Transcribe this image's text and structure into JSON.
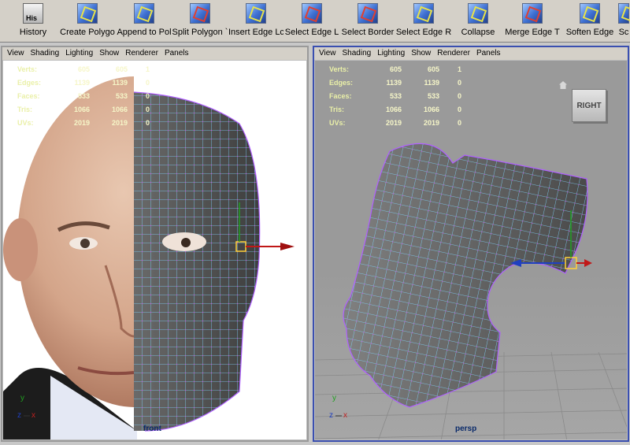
{
  "shelf": {
    "buttons": [
      {
        "label": "History",
        "icon": "history-icon",
        "badge": "His"
      },
      {
        "label": "Create Polygo",
        "icon": "create-polygon-icon"
      },
      {
        "label": "Append to Pol",
        "icon": "append-polygon-icon"
      },
      {
        "label": "Split Polygon `",
        "icon": "split-polygon-icon"
      },
      {
        "label": "Insert Edge Lc",
        "icon": "insert-edge-loop-icon"
      },
      {
        "label": "Select Edge L",
        "icon": "select-edge-loop-icon"
      },
      {
        "label": "Select Border",
        "icon": "select-border-icon"
      },
      {
        "label": "Select Edge R",
        "icon": "select-edge-ring-icon"
      },
      {
        "label": "Collapse",
        "icon": "collapse-icon"
      },
      {
        "label": "Merge Edge T",
        "icon": "merge-edge-icon"
      },
      {
        "label": "Soften Edge",
        "icon": "soften-edge-icon"
      },
      {
        "label": "Sc",
        "icon": "sculpt-icon"
      }
    ]
  },
  "panels": {
    "menu": [
      "View",
      "Shading",
      "Lighting",
      "Show",
      "Renderer",
      "Panels"
    ],
    "front": {
      "camera": "front",
      "hud": [
        {
          "name": "Verts:",
          "a": "605",
          "b": "605",
          "c": "1"
        },
        {
          "name": "Edges:",
          "a": "1139",
          "b": "1139",
          "c": "0"
        },
        {
          "name": "Faces:",
          "a": "533",
          "b": "533",
          "c": "0"
        },
        {
          "name": "Tris:",
          "a": "1066",
          "b": "1066",
          "c": "0"
        },
        {
          "name": "UVs:",
          "a": "2019",
          "b": "2019",
          "c": "0"
        }
      ],
      "axis": {
        "up": "y",
        "right": "x",
        "origin": "z"
      }
    },
    "persp": {
      "camera": "persp",
      "viewcube": "RIGHT",
      "hud": [
        {
          "name": "Verts:",
          "a": "605",
          "b": "605",
          "c": "1"
        },
        {
          "name": "Edges:",
          "a": "1139",
          "b": "1139",
          "c": "0"
        },
        {
          "name": "Faces:",
          "a": "533",
          "b": "533",
          "c": "0"
        },
        {
          "name": "Tris:",
          "a": "1066",
          "b": "1066",
          "c": "0"
        },
        {
          "name": "UVs:",
          "a": "2019",
          "b": "2019",
          "c": "0"
        }
      ],
      "axis": {
        "up": "y",
        "right": "x",
        "origin": "z"
      }
    }
  },
  "colors": {
    "active_border": "#3a4fb0",
    "wire": "#7fd8ff",
    "vertex": "#e040e0",
    "mesh": "#5a5a5a",
    "hud_text": "#f6f6c8"
  }
}
